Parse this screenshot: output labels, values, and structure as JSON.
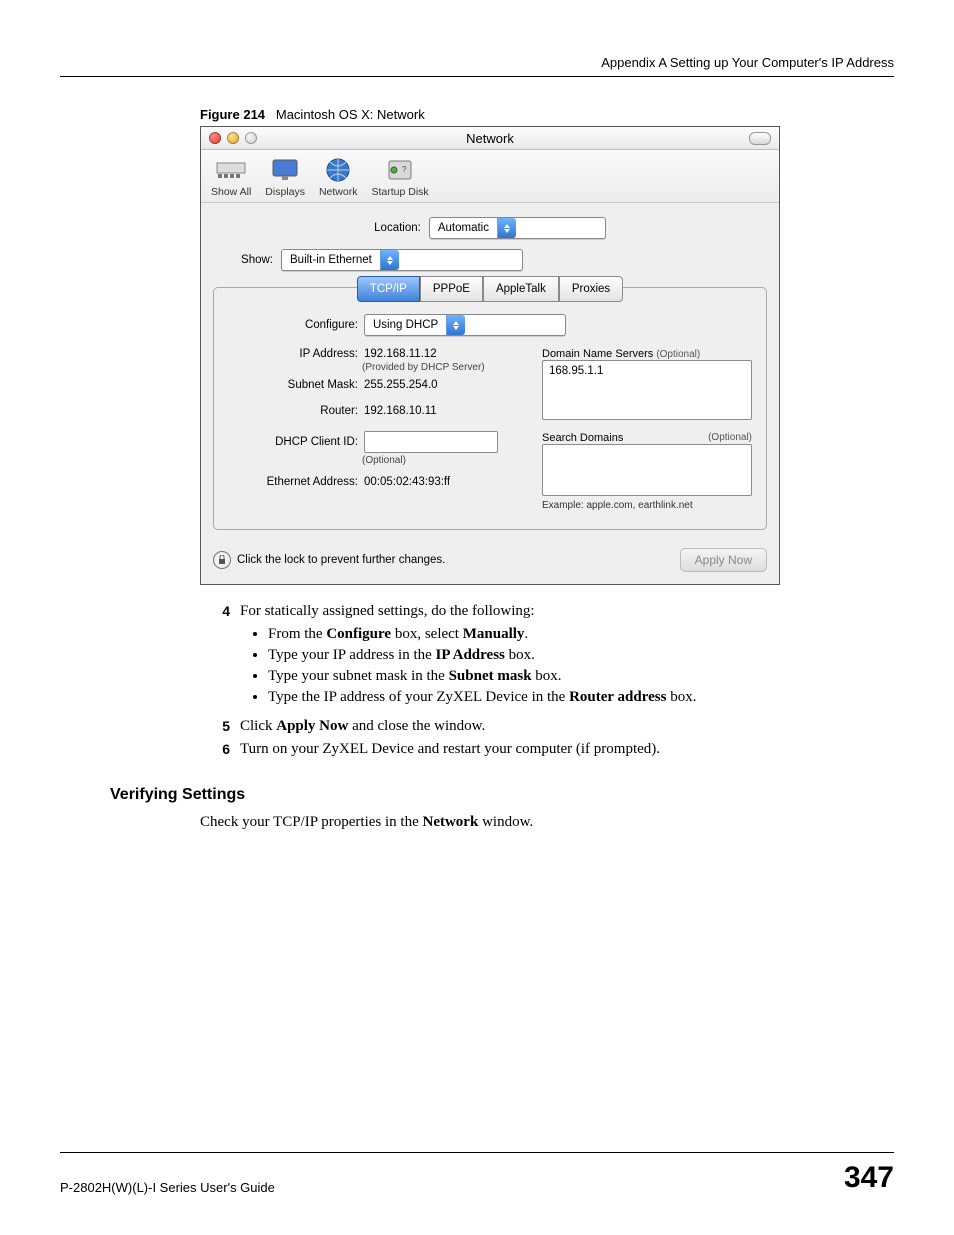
{
  "header": "Appendix A Setting up Your Computer's IP Address",
  "figure": {
    "num": "Figure 214",
    "title": "Macintosh OS X: Network"
  },
  "window": {
    "title": "Network",
    "toolbar": {
      "showall": "Show All",
      "displays": "Displays",
      "network": "Network",
      "startup": "Startup Disk"
    },
    "location_label": "Location:",
    "location_value": "Automatic",
    "show_label": "Show:",
    "show_value": "Built-in Ethernet",
    "tabs": {
      "tcpip": "TCP/IP",
      "pppoe": "PPPoE",
      "appletalk": "AppleTalk",
      "proxies": "Proxies"
    },
    "configure_label": "Configure:",
    "configure_value": "Using DHCP",
    "ip_label": "IP Address:",
    "ip_value": "192.168.11.12",
    "ip_note": "(Provided by DHCP Server)",
    "subnet_label": "Subnet Mask:",
    "subnet_value": "255.255.254.0",
    "router_label": "Router:",
    "router_value": "192.168.10.11",
    "dhcp_label": "DHCP Client ID:",
    "dhcp_value": "",
    "optional": "(Optional)",
    "eth_label": "Ethernet Address:",
    "eth_value": "00:05:02:43:93:ff",
    "dns_label": "Domain Name Servers",
    "dns_value": "168.95.1.1",
    "search_label": "Search Domains",
    "search_example": "Example: apple.com, earthlink.net",
    "lock_text": "Click the lock to prevent further changes.",
    "apply": "Apply Now"
  },
  "steps": {
    "s4": {
      "num": "4",
      "intro": "For statically assigned settings, do the following:",
      "b1a": "From the ",
      "b1b": "Configure",
      "b1c": " box, select ",
      "b1d": "Manually",
      "b1e": ".",
      "b2a": "Type your IP address in the ",
      "b2b": "IP Address",
      "b2c": " box.",
      "b3a": "Type your subnet mask in the ",
      "b3b": "Subnet mask",
      "b3c": " box.",
      "b4a": "Type the IP address of your ZyXEL Device in the ",
      "b4b": "Router address",
      "b4c": " box."
    },
    "s5": {
      "num": "5",
      "a": "Click ",
      "b": "Apply Now",
      "c": " and close the window."
    },
    "s6": {
      "num": "6",
      "text": "Turn on your ZyXEL Device and restart your computer (if prompted)."
    }
  },
  "verifying": {
    "heading": "Verifying Settings",
    "a": "Check your TCP/IP properties in the ",
    "b": "Network",
    "c": " window."
  },
  "footer": {
    "left": "P-2802H(W)(L)-I Series User's Guide",
    "page": "347"
  }
}
